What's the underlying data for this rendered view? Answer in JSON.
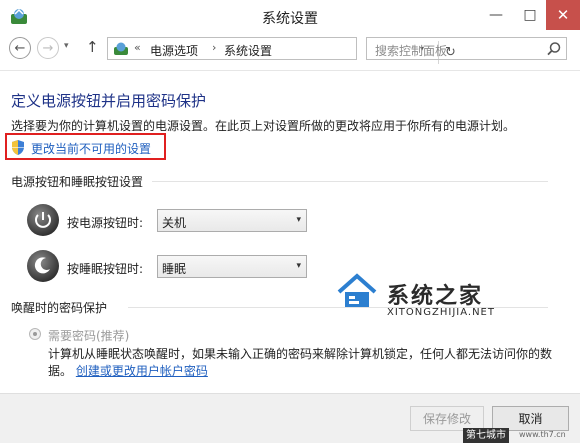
{
  "window": {
    "title": "系统设置",
    "minimize_glyph": "—",
    "maximize_glyph": "□",
    "close_glyph": "✕"
  },
  "nav": {
    "back_glyph": "←",
    "forward_glyph": "→",
    "dropdown_glyph": "▾",
    "up_glyph": "↑",
    "address_chevron": "«",
    "breadcrumbs": [
      "电源选项",
      "系统设置"
    ],
    "breadcrumb_separator": "›",
    "refresh_glyph": "↻",
    "search_placeholder": "搜索控制面板"
  },
  "main": {
    "title": "定义电源按钮并启用密码保护",
    "description": "选择要为你的计算机设置的电源设置。在此页上对设置所做的更改将应用于你所有的电源计划。",
    "change_link": "更改当前不可用的设置",
    "power_section": {
      "heading": "电源按钮和睡眠按钮设置",
      "power_button_label": "按电源按钮时:",
      "power_button_value": "关机",
      "sleep_button_label": "按睡眠按钮时:",
      "sleep_button_value": "睡眠"
    },
    "password_section": {
      "heading": "唤醒时的密码保护",
      "require_password_label": "需要密码(推荐)",
      "description": "计算机从睡眠状态唤醒时，如果未输入正确的密码来解除计算机锁定，任何人都无法访问你的数据。",
      "account_link": "创建或更改用户帐户密码"
    }
  },
  "footer": {
    "save_label": "保存修改",
    "cancel_label": "取消"
  },
  "watermark": {
    "name": "系统之家",
    "url": "XITONGZHIJIA.NET",
    "corner": "第七城市",
    "corner_url": "www.th7.cn"
  },
  "colors": {
    "title_blue": "#1e3287",
    "link_blue": "#1f5fbf",
    "highlight_red": "#e02020",
    "close_red": "#c7504b"
  }
}
